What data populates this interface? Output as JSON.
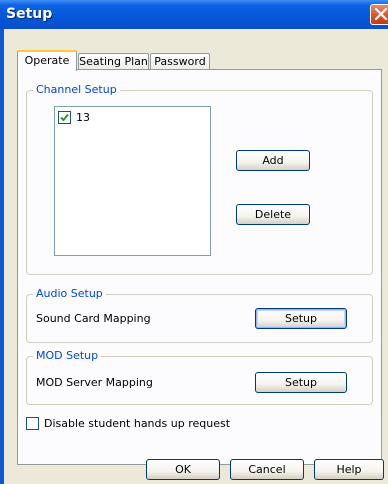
{
  "window": {
    "title": "Setup"
  },
  "tabs": [
    {
      "label": "Operate",
      "active": true
    },
    {
      "label": "Seating Plan",
      "active": false
    },
    {
      "label": "Password",
      "active": false
    }
  ],
  "channel_setup": {
    "legend": "Channel Setup",
    "channels": [
      {
        "label": "13",
        "checked": true
      }
    ],
    "add_label": "Add",
    "delete_label": "Delete"
  },
  "audio_setup": {
    "legend": "Audio Setup",
    "label": "Sound Card Mapping",
    "button_label": "Setup"
  },
  "mod_setup": {
    "legend": "MOD Setup",
    "label": "MOD Server Mapping",
    "button_label": "Setup"
  },
  "options": {
    "disable_hands_up_label": "Disable student hands up request",
    "disable_hands_up_checked": false
  },
  "footer": {
    "ok_label": "OK",
    "cancel_label": "Cancel",
    "help_label": "Help"
  },
  "colors": {
    "titlebar": "#0556d8",
    "dialog_bg": "#ece9d8",
    "panel_bg": "#fcfcfe",
    "group_legend": "#0046d5",
    "tab_highlight": "#ffc83c",
    "close_button": "#d85a35"
  }
}
